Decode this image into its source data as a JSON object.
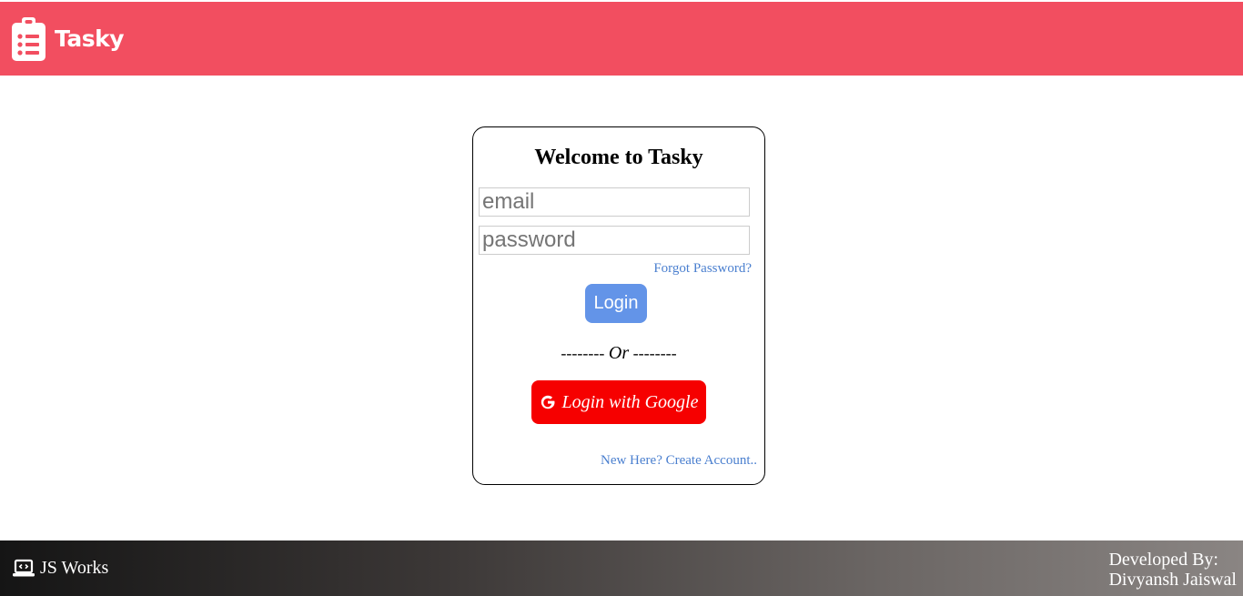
{
  "app": {
    "name": "Tasky"
  },
  "login": {
    "title": "Welcome to Tasky",
    "email_placeholder": "email",
    "password_placeholder": "password",
    "forgot_password": "Forgot Password?",
    "login_label": "Login",
    "divider_left": "-------- ",
    "divider_or": "Or",
    "divider_right": " --------",
    "google_label": "Login with Google",
    "create_account": "New Here? Create Account.."
  },
  "footer": {
    "brand": "JS Works",
    "developed_by": "Developed By:",
    "developer": "Divyansh Jaiswal"
  },
  "colors": {
    "navbar": "#f24e60",
    "login_button": "#6394e8",
    "google_button": "#f60000",
    "link": "#4a7fcf"
  },
  "icons": {
    "brand": "clipboard-list-icon",
    "google": "google-g-icon",
    "footer": "laptop-code-icon"
  }
}
